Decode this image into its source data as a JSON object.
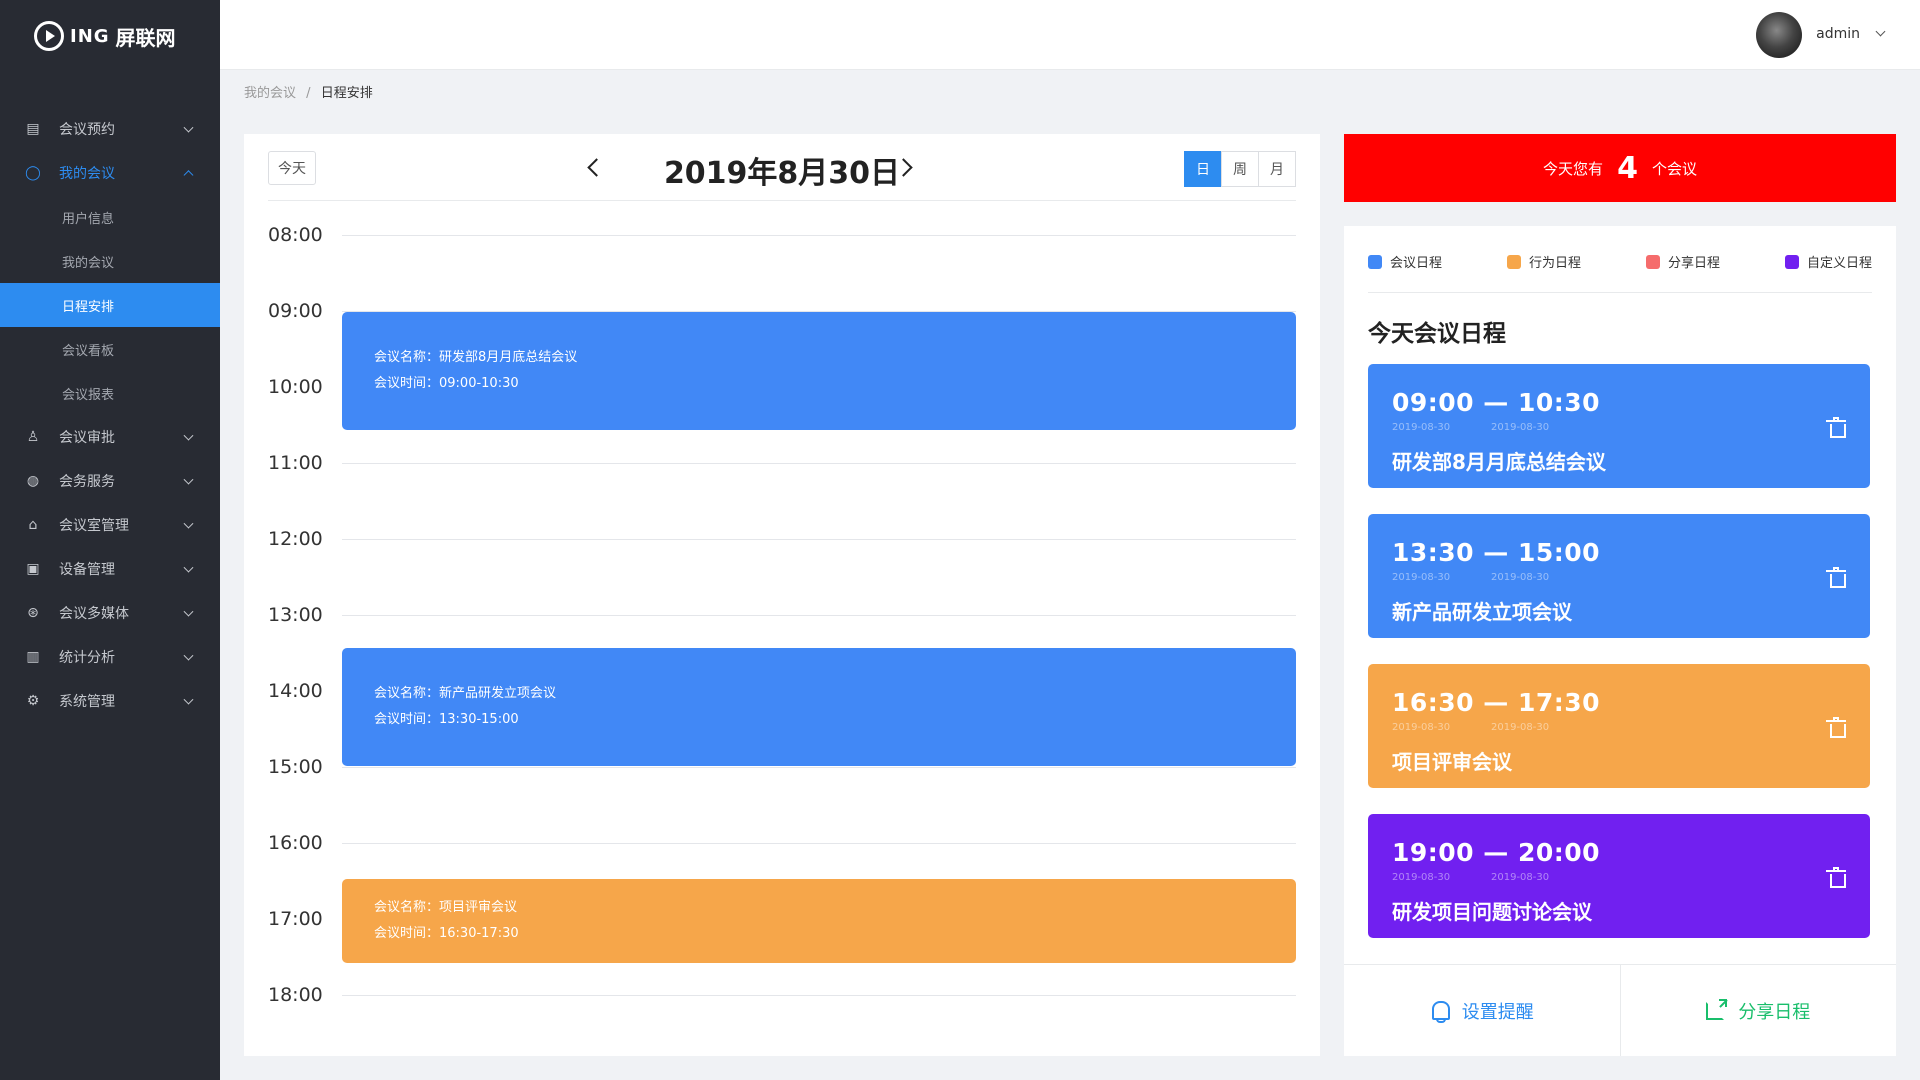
{
  "brand": {
    "ing": "ING",
    "name": "屏联网"
  },
  "menu": [
    {
      "label": "会议预约",
      "icon": "calendar-icon"
    },
    {
      "label": "我的会议",
      "icon": "user-icon",
      "open": true
    },
    {
      "label": "会议审批",
      "icon": "stamp-icon"
    },
    {
      "label": "会务服务",
      "icon": "service-icon"
    },
    {
      "label": "会议室管理",
      "icon": "room-icon"
    },
    {
      "label": "设备管理",
      "icon": "device-icon"
    },
    {
      "label": "会议多媒体",
      "icon": "media-icon"
    },
    {
      "label": "统计分析",
      "icon": "chart-icon"
    },
    {
      "label": "系统管理",
      "icon": "gear-icon"
    }
  ],
  "submenu": [
    {
      "label": "用户信息"
    },
    {
      "label": "我的会议"
    },
    {
      "label": "日程安排",
      "active": true
    },
    {
      "label": "会议看板"
    },
    {
      "label": "会议报表"
    }
  ],
  "user": {
    "name": "admin"
  },
  "breadcrumb": {
    "parent": "我的会议",
    "sep": "/",
    "current": "日程安排"
  },
  "calendar": {
    "today_label": "今天",
    "date_title": "2019年8月30日",
    "views": [
      {
        "label": "日",
        "active": true
      },
      {
        "label": "周"
      },
      {
        "label": "月"
      }
    ],
    "hours": [
      "08:00",
      "09:00",
      "10:00",
      "11:00",
      "12:00",
      "13:00",
      "14:00",
      "15:00",
      "16:00",
      "17:00",
      "18:00"
    ],
    "events": [
      {
        "name": "会议名称：研发部8月月底总结会议",
        "time": "会议时间：09:00-10:30",
        "color": "#4188f6"
      },
      {
        "name": "会议名称：新产品研发立项会议",
        "time": "会议时间：13:30-15:00",
        "color": "#4188f6"
      },
      {
        "name": "会议名称：项目评审会议",
        "time": "会议时间：16:30-17:30",
        "color": "#f6a64a"
      }
    ]
  },
  "summary": {
    "prefix": "今天您有",
    "count": "4",
    "suffix": "个会议",
    "color": "#ff0000"
  },
  "legend": [
    {
      "label": "会议日程",
      "color": "#4188f6"
    },
    {
      "label": "行为日程",
      "color": "#f6a64a"
    },
    {
      "label": "分享日程",
      "color": "#f56c6c"
    },
    {
      "label": "自定义日程",
      "color": "#7120f0"
    }
  ],
  "panel_title": "今天会议日程",
  "cards": [
    {
      "time": "09:00 — 10:30",
      "d1": "2019-08-30",
      "d2": "2019-08-30",
      "name": "研发部8月月底总结会议",
      "color": "#4188f6"
    },
    {
      "time": "13:30 — 15:00",
      "d1": "2019-08-30",
      "d2": "2019-08-30",
      "name": "新产品研发立项会议",
      "color": "#4188f6"
    },
    {
      "time": "16:30 — 17:30",
      "d1": "2019-08-30",
      "d2": "2019-08-30",
      "name": "项目评审会议",
      "color": "#f6a64a"
    },
    {
      "time": "19:00 — 20:00",
      "d1": "2019-08-30",
      "d2": "2019-08-30",
      "name": "研发项目问题讨论会议",
      "color": "#7120f0"
    }
  ],
  "footer": {
    "remind": "设置提醒",
    "share": "分享日程",
    "remind_color": "#2d8cf0",
    "share_color": "#19be6b"
  }
}
